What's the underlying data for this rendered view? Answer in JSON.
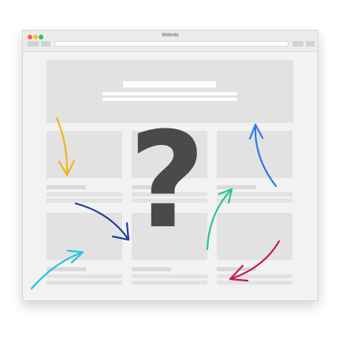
{
  "window": {
    "title": "Website",
    "traffic_lights": [
      "#ff5f57",
      "#febc2e",
      "#28c840"
    ]
  },
  "overlay": {
    "symbol": "?",
    "symbol_color": "#4a4a4a"
  },
  "arrows": [
    {
      "name": "arrow-yellow",
      "color": "#f5b21d"
    },
    {
      "name": "arrow-navy",
      "color": "#1f3f9a"
    },
    {
      "name": "arrow-cyan",
      "color": "#1ec3e0"
    },
    {
      "name": "arrow-green",
      "color": "#2ac48f"
    },
    {
      "name": "arrow-blue",
      "color": "#2f7be6"
    },
    {
      "name": "arrow-crimson",
      "color": "#c2185b"
    }
  ]
}
